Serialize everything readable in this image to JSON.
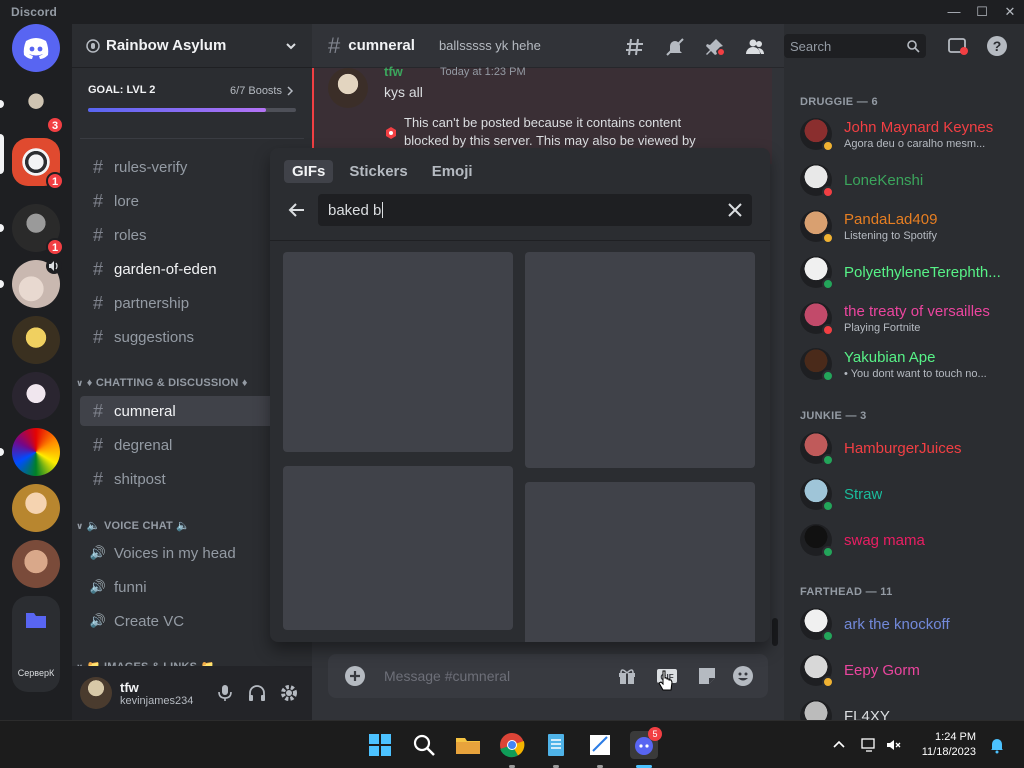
{
  "window": {
    "title": "Discord"
  },
  "rail": {
    "badges": [
      "3",
      "1",
      "1"
    ],
    "folder_label": "СерверК"
  },
  "guild": {
    "name": "Rainbow Asylum",
    "boost_goal": "GOAL: LVL 2",
    "boost_count": "6/7 Boosts",
    "boost_progress": 0.857
  },
  "channels": {
    "top": [
      {
        "name": "rules-verify",
        "type": "text"
      },
      {
        "name": "lore",
        "type": "text"
      },
      {
        "name": "roles",
        "type": "text"
      },
      {
        "name": "garden-of-eden",
        "type": "text"
      },
      {
        "name": "partnership",
        "type": "text"
      },
      {
        "name": "suggestions",
        "type": "text"
      }
    ],
    "category_chat": "♦ CHATTING & DISCUSSION ♦",
    "chat": [
      {
        "name": "cumneral",
        "type": "text"
      },
      {
        "name": "degrenal",
        "type": "text"
      },
      {
        "name": "shitpost",
        "type": "text"
      }
    ],
    "category_voice": "VOICE CHAT",
    "voice": [
      {
        "name": "Voices in my head",
        "type": "voice"
      },
      {
        "name": "funni",
        "type": "voice"
      },
      {
        "name": "Create VC",
        "type": "voice"
      }
    ],
    "category_images": "IMAGES & LINKS"
  },
  "user": {
    "name": "tfw",
    "handle": "kevinjames234"
  },
  "chat": {
    "channel": "cumneral",
    "topic": "ballsssss yk hehe",
    "message": {
      "author": "tfw",
      "time": "Today at 1:23 PM",
      "text": "kys all",
      "warning": "This can't be posted because it contains content blocked by this server. This may also be viewed by"
    },
    "composer_placeholder": "Message #cumneral"
  },
  "picker": {
    "tabs": [
      "GIFs",
      "Stickers",
      "Emoji"
    ],
    "search_value": "baked b"
  },
  "members_search_placeholder": "Search",
  "member_groups": [
    {
      "title": "DRUGGIE — 6",
      "members": [
        {
          "name": "John Maynard Keynes",
          "sub": "Agora deu o caralho mesm...",
          "color": "#f23f43",
          "status": "#f0b232"
        },
        {
          "name": "LoneKenshi",
          "sub": "",
          "color": "#3ba55c",
          "status": "#f23f43"
        },
        {
          "name": "PandaLad409",
          "sub": "Listening to Spotify",
          "color": "#e67e22",
          "status": "#f0b232"
        },
        {
          "name": "PolyethyleneTerephth...",
          "sub": "",
          "color": "#57f287",
          "status": "#23a55a"
        },
        {
          "name": "the treaty of versailles",
          "sub": "Playing Fortnite",
          "color": "#eb459e",
          "status": "#f23f43"
        },
        {
          "name": "Yakubian Ape",
          "sub": "• You dont want to touch no...",
          "color": "#57f287",
          "status": "#23a55a"
        }
      ]
    },
    {
      "title": "JUNKIE — 3",
      "members": [
        {
          "name": "HamburgerJuices",
          "sub": "",
          "color": "#f23f43",
          "status": "#23a55a"
        },
        {
          "name": "Straw",
          "sub": "",
          "color": "#1abc9c",
          "status": "#23a55a"
        },
        {
          "name": "swag mama",
          "sub": "",
          "color": "#e91e63",
          "status": "#23a55a"
        }
      ]
    },
    {
      "title": "FARTHEAD — 11",
      "members": [
        {
          "name": "ark the knockoff",
          "sub": "",
          "color": "#7289da",
          "status": "#23a55a"
        },
        {
          "name": "Eepy Gorm",
          "sub": "",
          "color": "#eb459e",
          "status": "#f0b232"
        },
        {
          "name": "FL4XY",
          "sub": "",
          "color": "#dbdee1",
          "status": "#23a55a"
        }
      ]
    }
  ],
  "taskbar": {
    "time": "1:24 PM",
    "date": "11/18/2023",
    "discord_badge": "5"
  }
}
